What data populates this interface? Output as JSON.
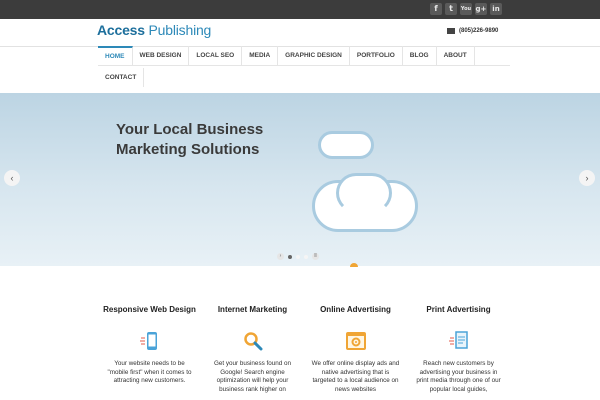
{
  "header": {
    "logo_part1": "Access",
    "logo_part2": "Publishing",
    "phone": "(805)226-9890"
  },
  "social": [
    {
      "name": "facebook-icon",
      "glyph": "f"
    },
    {
      "name": "twitter-icon",
      "glyph": "t"
    },
    {
      "name": "youtube-icon",
      "glyph": "You"
    },
    {
      "name": "googleplus-icon",
      "glyph": "g+"
    },
    {
      "name": "linkedin-icon",
      "glyph": "in"
    }
  ],
  "nav": {
    "items": [
      "HOME",
      "WEB DESIGN",
      "LOCAL SEO",
      "MEDIA",
      "GRAPHIC DESIGN",
      "PORTFOLIO",
      "BLOG",
      "ABOUT"
    ],
    "contact": "CONTACT"
  },
  "hero": {
    "title_line1": "Your Local Business",
    "title_line2": "Marketing Solutions",
    "prev": "‹",
    "next": "›"
  },
  "features": [
    {
      "title": "Responsive Web Design",
      "desc": "Your website needs to be \"mobile first\" when it comes to attracting new customers."
    },
    {
      "title": "Internet Marketing",
      "desc": "Get your business found on Google! Search engine optimization will help your business rank higher on"
    },
    {
      "title": "Online Advertising",
      "desc": "We offer online display ads and native advertising that is targeted to a local audience on news websites"
    },
    {
      "title": "Print Advertising",
      "desc": "Reach new customers by advertising your business in print media through one of our popular local guides,"
    }
  ],
  "colors": {
    "accent": "#2d89b8",
    "topbar": "#3c3c3c",
    "icon_orange": "#f0a535",
    "icon_blue": "#4aa3d8"
  }
}
